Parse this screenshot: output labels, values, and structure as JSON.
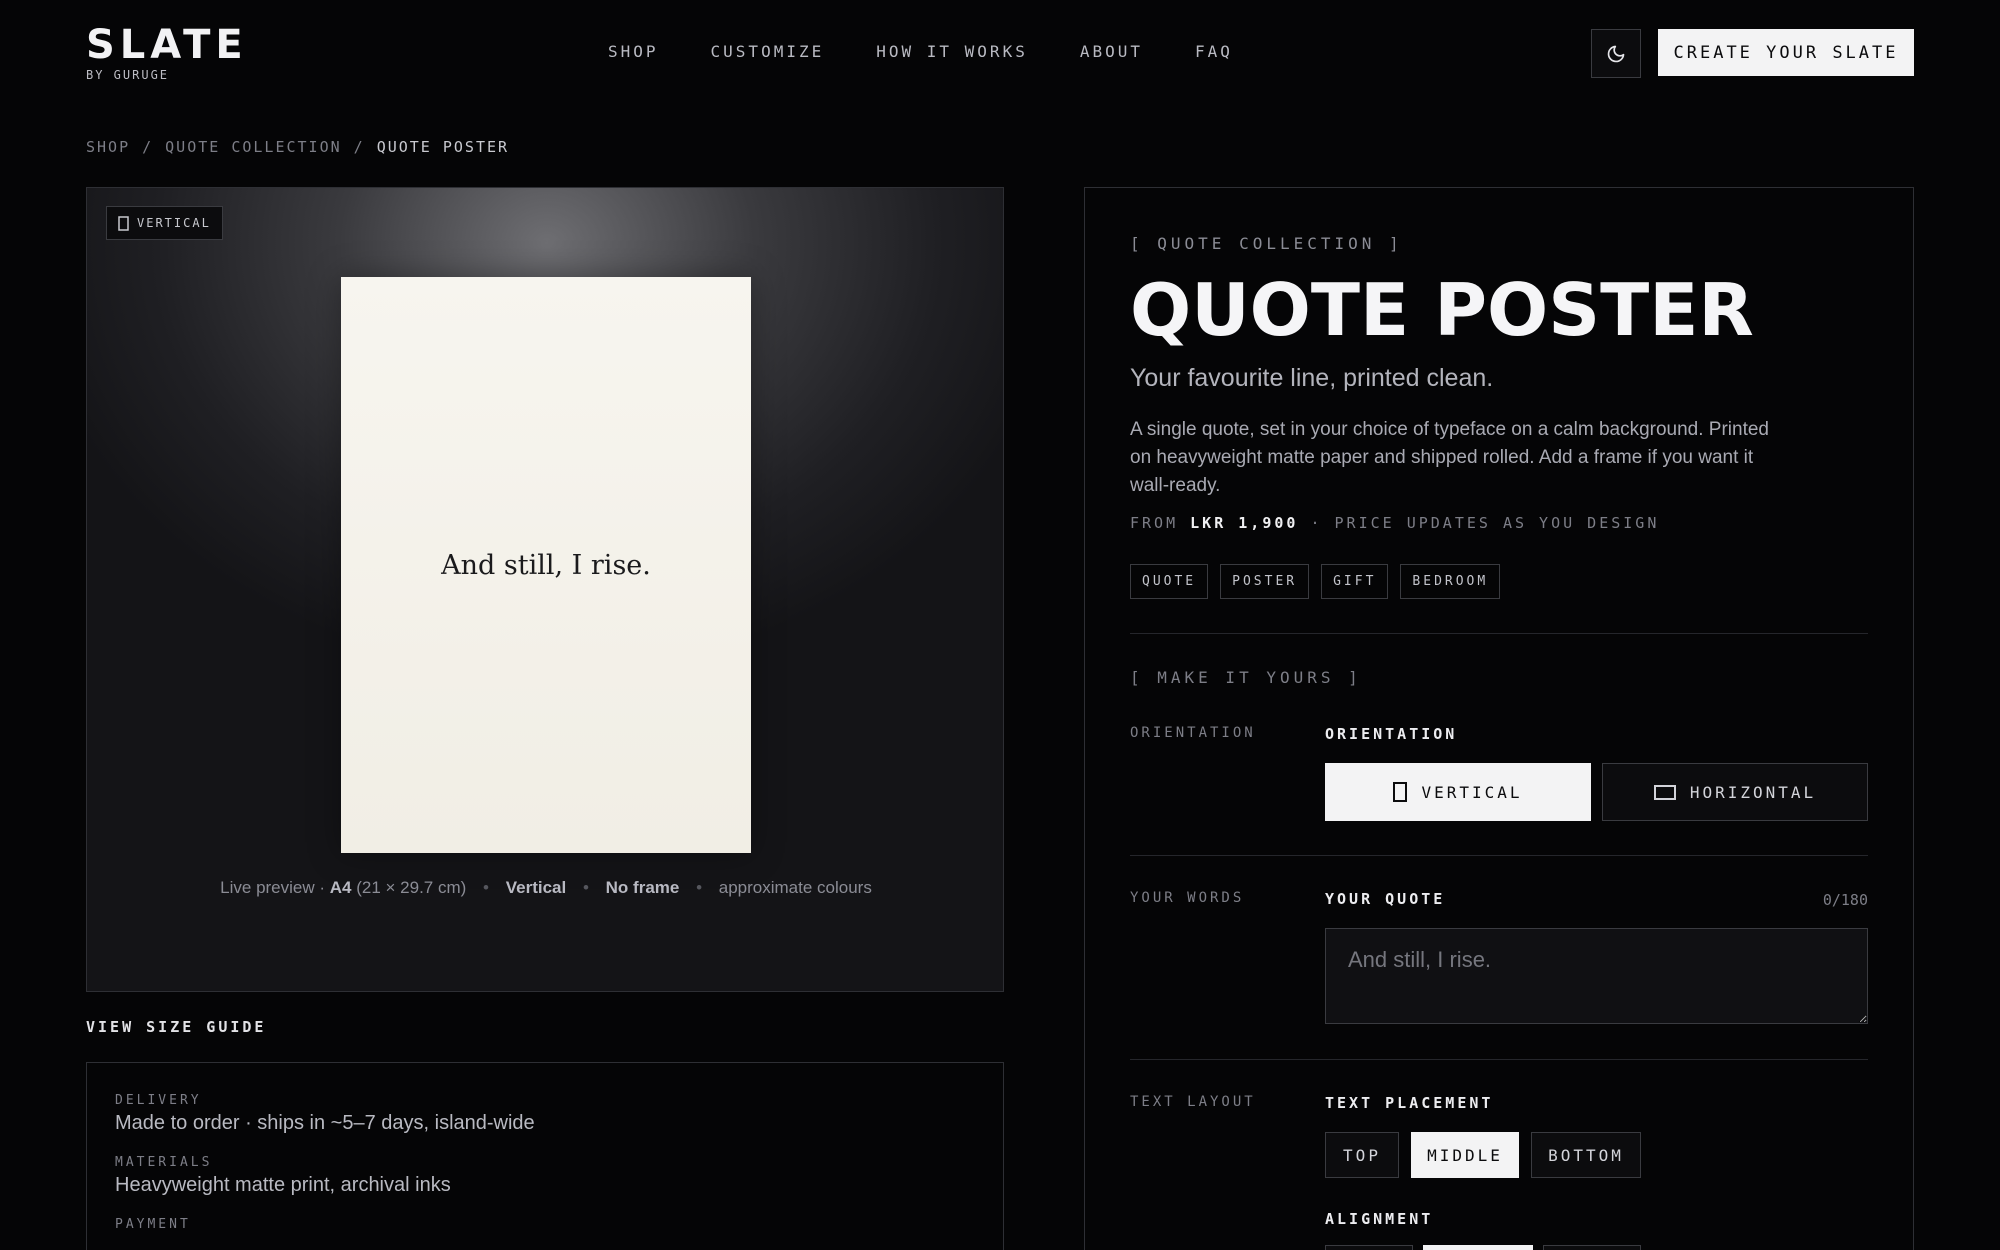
{
  "brand": {
    "name": "SLATE",
    "sub": "BY GURUGE"
  },
  "nav": [
    "SHOP",
    "CUSTOMIZE",
    "HOW IT WORKS",
    "ABOUT",
    "FAQ"
  ],
  "header": {
    "cta": "CREATE YOUR SLATE",
    "theme_icon": "moon-icon"
  },
  "breadcrumb": {
    "items": [
      "SHOP",
      "QUOTE COLLECTION"
    ],
    "current": "QUOTE POSTER",
    "separator": "/"
  },
  "preview": {
    "orientation_chip": "VERTICAL",
    "quote": "And still, I rise.",
    "caption": {
      "prefix": "Live preview · ",
      "size": "A4",
      "dims": " (21 × 29.7 cm)",
      "orientation": "Vertical",
      "frame": "No frame",
      "note": "approximate colours"
    }
  },
  "size_guide": "VIEW SIZE GUIDE",
  "info": [
    {
      "label": "DELIVERY",
      "value": "Made to order · ships in ~5–7 days, island-wide"
    },
    {
      "label": "MATERIALS",
      "value": "Heavyweight matte print, archival inks"
    },
    {
      "label": "PAYMENT",
      "value": ""
    }
  ],
  "product": {
    "eyebrow": "[ QUOTE COLLECTION ]",
    "title": "QUOTE POSTER",
    "subtitle": "Your favourite line, printed clean.",
    "description": "A single quote, set in your choice of typeface on a calm background. Printed on heavyweight matte paper and shipped rolled. Add a frame if you want it wall-ready.",
    "price_prefix": "FROM ",
    "price": "LKR 1,900",
    "price_suffix": " · PRICE UPDATES AS YOU DESIGN",
    "tags": [
      "QUOTE",
      "POSTER",
      "GIFT",
      "BEDROOM"
    ]
  },
  "customize": {
    "eyebrow": "[ MAKE IT YOURS ]",
    "orientation": {
      "row_label": "ORIENTATION",
      "label": "ORIENTATION",
      "options": [
        "VERTICAL",
        "HORIZONTAL"
      ],
      "selected": "VERTICAL"
    },
    "words": {
      "row_label": "YOUR WORDS",
      "label": "YOUR QUOTE",
      "counter": "0/180",
      "placeholder": "And still, I rise.",
      "value": ""
    },
    "layout": {
      "row_label": "TEXT LAYOUT",
      "label": "TEXT PLACEMENT",
      "options": [
        "TOP",
        "MIDDLE",
        "BOTTOM"
      ],
      "selected": "MIDDLE",
      "alignment_label": "ALIGNMENT"
    }
  },
  "colors": {
    "background": "#050506",
    "accent": "#f3f3f4",
    "border": "#3a3b40"
  }
}
